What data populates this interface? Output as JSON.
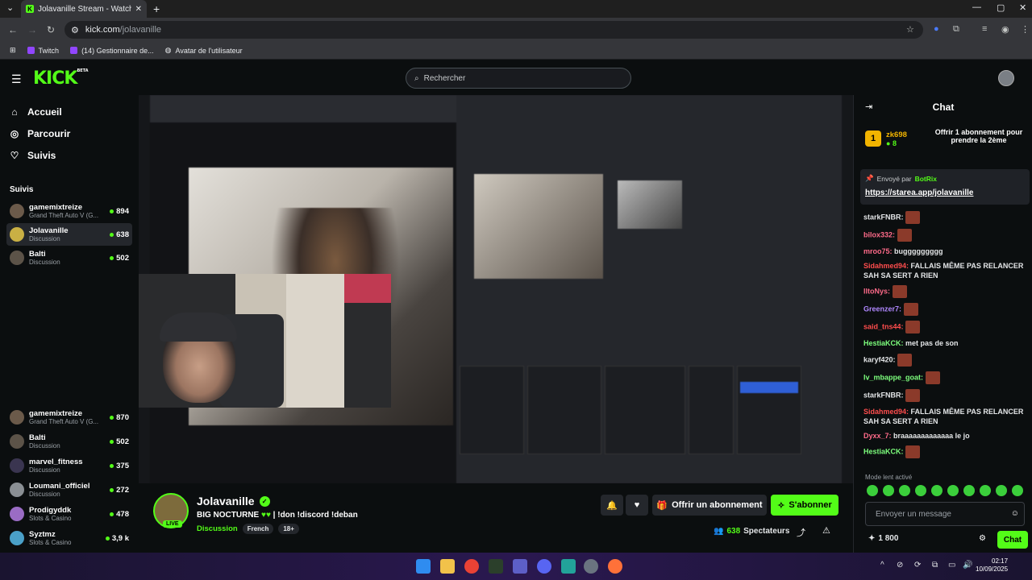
{
  "browser": {
    "tab_title": "Jolavanille Stream - Watch Live",
    "url_host": "kick.com",
    "url_path": "/jolavanille",
    "bookmarks": [
      "Twitch",
      "(14) Gestionnaire de...",
      "Avatar de l'utilisateur"
    ]
  },
  "header": {
    "logo": "KICK",
    "logo_sup": "BETA",
    "search_placeholder": "Rechercher"
  },
  "sidebar": {
    "nav": [
      {
        "label": "Accueil",
        "icon": "home-icon"
      },
      {
        "label": "Parcourir",
        "icon": "compass-icon"
      },
      {
        "label": "Suivis",
        "icon": "heart-icon"
      }
    ],
    "section_title": "Suivis",
    "followed_top": [
      {
        "name": "gamemixtreize",
        "category": "Grand Theft Auto V (G...",
        "viewers": "894"
      },
      {
        "name": "Jolavanille",
        "category": "Discussion",
        "viewers": "638"
      },
      {
        "name": "Balti",
        "category": "Discussion",
        "viewers": "502"
      }
    ],
    "followed_bottom": [
      {
        "name": "gamemixtreize",
        "category": "Grand Theft Auto V (G...",
        "viewers": "870"
      },
      {
        "name": "Balti",
        "category": "Discussion",
        "viewers": "502"
      },
      {
        "name": "marvel_fitness",
        "category": "Discussion",
        "viewers": "375"
      },
      {
        "name": "Loumani_officiel",
        "category": "Discussion",
        "viewers": "272"
      },
      {
        "name": "Prodigyddk",
        "category": "Slots & Casino",
        "viewers": "478"
      },
      {
        "name": "Syztmz",
        "category": "Slots & Casino",
        "viewers": "3,9 k"
      }
    ]
  },
  "stream": {
    "channel": "Jolavanille",
    "live_badge": "LIVE",
    "title_prefix": "BIG NOCTURNE",
    "title_suffix": "| !don !discord !deban",
    "category": "Discussion",
    "tags": [
      "French",
      "18+"
    ],
    "gift_label": "Offrir un abonnement",
    "subscribe_label": "S'abonner",
    "viewers_count": "638",
    "viewers_label": "Spectateurs"
  },
  "chat": {
    "title": "Chat",
    "gifter_name": "zk698",
    "gifter_count": "8",
    "gift_text": "Offrir 1 abonnement pour prendre la 2ème",
    "pinned_by": "Envoyé par",
    "pinned_bot": "BotRix",
    "pinned_link": "https://starea.app/jolavanille",
    "messages": [
      {
        "user": "starkFNBR:",
        "color": "#e4e6e8",
        "text": "",
        "emote": true
      },
      {
        "user": "bilox332:",
        "color": "#ff6b8a",
        "text": "",
        "emote": true
      },
      {
        "user": "mroo75:",
        "color": "#ff6b8a",
        "text": "buggggggggg",
        "emote": false
      },
      {
        "user": "Sidahmed94:",
        "color": "#ff4d4d",
        "text": "FALLAIS MÊME PAS RELANCER SAH SA SERT A RIEN",
        "emote": false
      },
      {
        "user": "lltoNys:",
        "color": "#ff6b8a",
        "text": "",
        "emote": true
      },
      {
        "user": "Greenzer7:",
        "color": "#b088ff",
        "text": "",
        "emote": true
      },
      {
        "user": "said_tns44:",
        "color": "#ff4d4d",
        "text": "",
        "emote": true
      },
      {
        "user": "HestiaKCK:",
        "color": "#7dff7d",
        "text": "met pas de son",
        "emote": false
      },
      {
        "user": "karyf420:",
        "color": "#e4e6e8",
        "text": "",
        "emote": true
      },
      {
        "user": "lv_mbappe_goat:",
        "color": "#7dff7d",
        "text": "",
        "emote": true
      },
      {
        "user": "starkFNBR:",
        "color": "#e4e6e8",
        "text": "",
        "emote": true
      },
      {
        "user": "Sidahmed94:",
        "color": "#ff4d4d",
        "text": "FALLAIS MÊME PAS RELANCER SAH SA SERT A RIEN",
        "emote": false
      },
      {
        "user": "Dyxx_7:",
        "color": "#ff6b8a",
        "text": "braaaaaaaaaaaaa le jo",
        "emote": false
      },
      {
        "user": "HestiaKCK:",
        "color": "#7dff7d",
        "text": "",
        "emote": true
      }
    ],
    "slow_mode": "Mode lent activé",
    "input_placeholder": "Envoyer un message",
    "points": "1 800",
    "send_label": "Chat"
  },
  "taskbar": {
    "time": "02:17",
    "date": "10/09/2025"
  }
}
